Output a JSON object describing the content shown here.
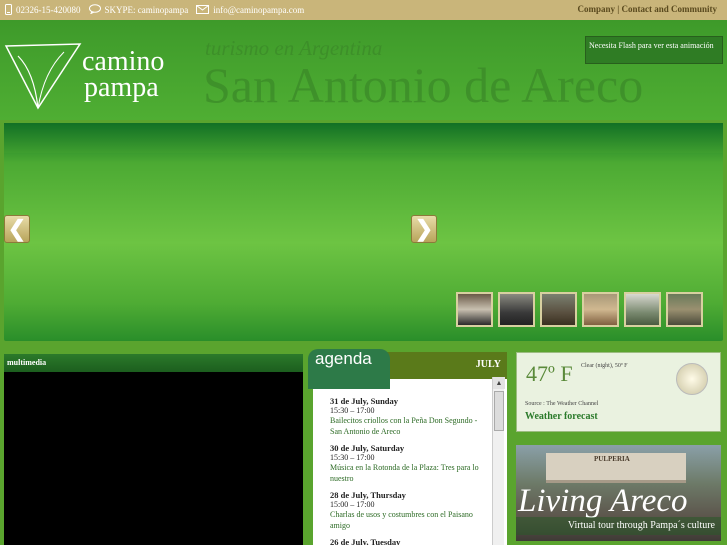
{
  "topbar": {
    "phone": "02326-15-420080",
    "skype": "SKYPE: caminopampa",
    "email": "info@caminopampa.com",
    "links": "Company | Contact and  Community"
  },
  "header": {
    "logo_line1": "camino",
    "logo_line2": "pampa",
    "ghost_subtitle": "turismo en Argentina",
    "ghost_title": "San Antonio de Areco",
    "flash_notice": "Necesita Flash para ver esta animación"
  },
  "banner": {
    "prev_label": "❮",
    "next_label": "❯",
    "thumb_count": 6
  },
  "multimedia": {
    "title": "multimedia"
  },
  "agenda": {
    "tab_label": "agenda",
    "month": "JULY",
    "events": [
      {
        "date": "31 de July, Sunday",
        "time": "15:30 – 17:00",
        "title": "Bailecitos criollos con la Peña Don Segundo - San Antonio de Areco"
      },
      {
        "date": "30 de July, Saturday",
        "time": "15:30 – 17:00",
        "title": "Música en la Rotonda de la Plaza: Tres para lo nuestro"
      },
      {
        "date": "28 de July, Thursday",
        "time": "15:00 – 17:00",
        "title": "Charlas de usos y costumbres con el Paisano amigo"
      },
      {
        "date": "26 de July, Tuesday",
        "time": "",
        "title": ""
      }
    ]
  },
  "weather": {
    "temperature": "47º F",
    "description": "Clear (night), 50º F",
    "source": "Source : The Weather Channel",
    "link_label": "Weather forecast"
  },
  "living": {
    "sign": "PULPERIA",
    "title": "Living Areco",
    "subtitle": "Virtual tour through Pampa´s culture"
  }
}
